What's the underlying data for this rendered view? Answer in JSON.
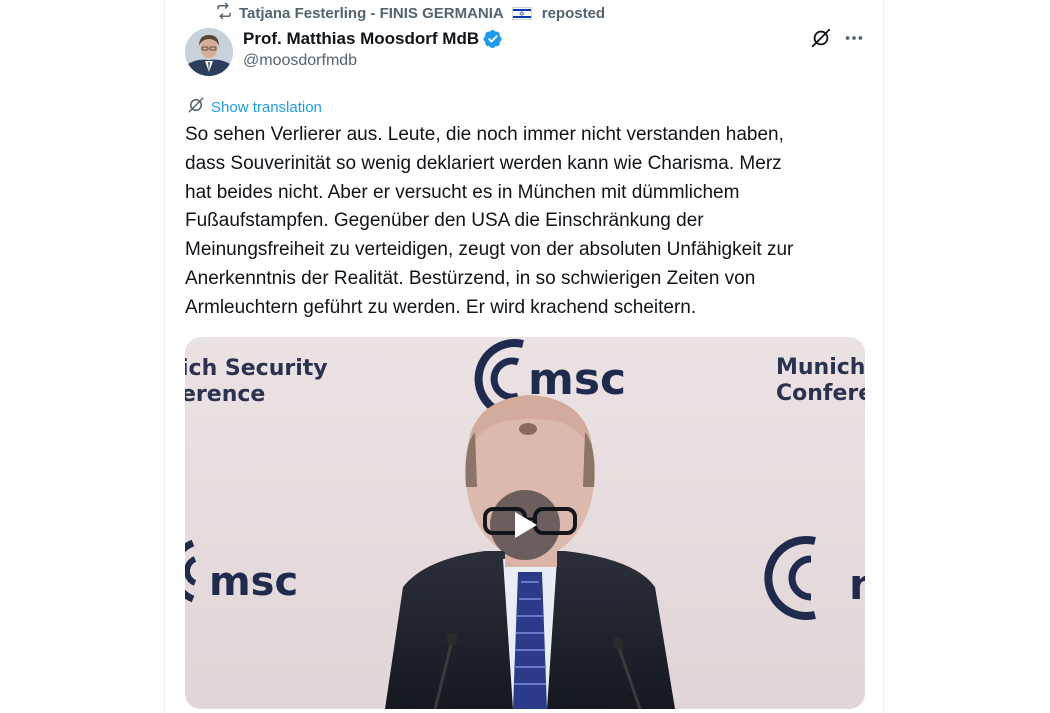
{
  "repost": {
    "reposter": "Tatjana Festerling - FINIS GERMANIA",
    "label": "reposted",
    "flag_icon": "israel-flag-icon"
  },
  "author": {
    "display_name": "Prof. Matthias Moosdorf MdB",
    "handle": "@moosdorfmdb",
    "verified_color": "#1d9bf0"
  },
  "actions": {
    "grok_icon": "grok-icon",
    "more_icon": "more-icon"
  },
  "translate": {
    "label": "Show translation"
  },
  "tweet": {
    "text": "So sehen Verlierer aus. Leute, die noch immer nicht verstanden haben,\ndass Souverinität so wenig deklariert werden kann wie Charisma. Merz\nhat beides nicht. Aber er versucht es in München mit dümmlichem\nFußaufstampfen. Gegenüber den USA die Einschränkung der\nMeinungsfreiheit zu verteidigen, zeugt von der absoluten Unfähigkeit zur\nAnerkenntnis der Realität. Bestürzend, in so schwierigen Zeiten von\nArmleuchtern geführt zu werden. Er wird krachend scheitern."
  },
  "media": {
    "type": "video",
    "left_sign": [
      "ich Security",
      "erence"
    ],
    "top_logo": "msc",
    "right_sign": [
      "Munich",
      "Conferen"
    ],
    "left_logo": "msc",
    "right_logo": "n",
    "play_icon": "play-icon"
  },
  "colors": {
    "accent": "#1d9bf0",
    "secondary_text": "#536471",
    "logo_dark": "#1f2a4d",
    "backdrop": "#e9dfe0"
  }
}
